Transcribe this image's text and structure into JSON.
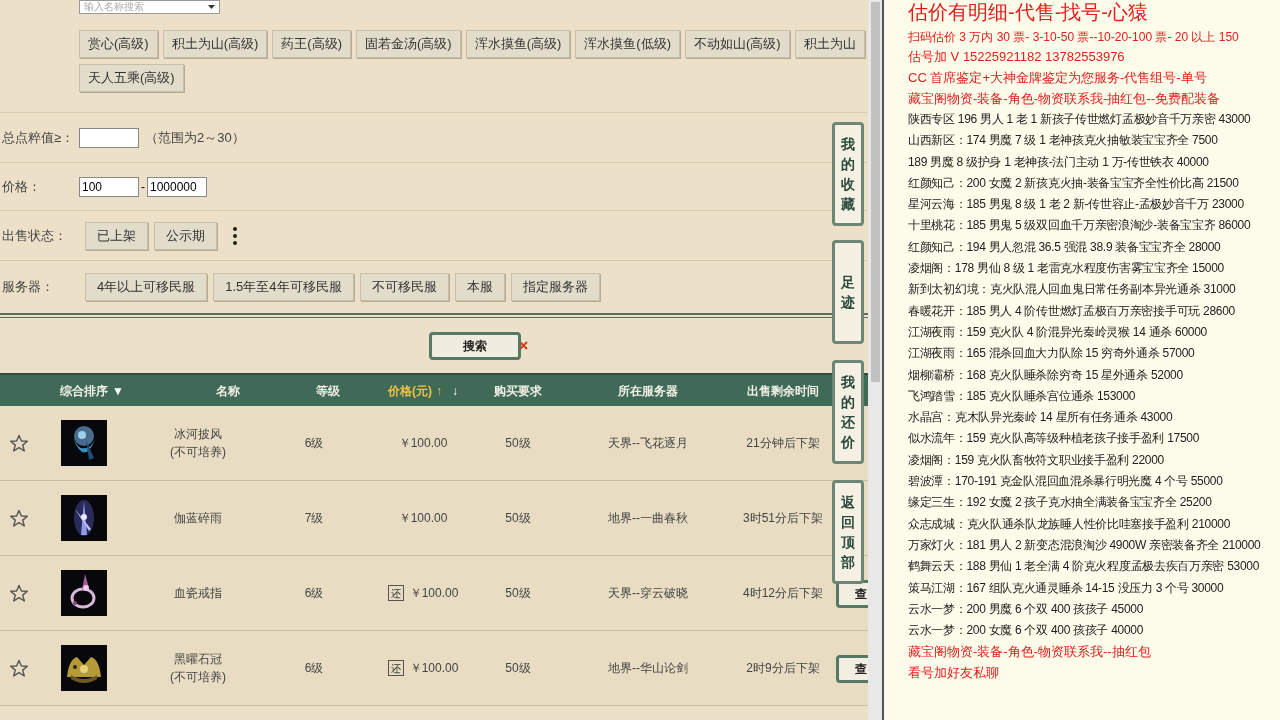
{
  "search_select": {
    "placeholder": "输入名称搜索"
  },
  "skill_buttons": [
    "赏心(高级)",
    "积土为山(高级)",
    "药王(高级)",
    "固若金汤(高级)",
    "浑水摸鱼(高级)",
    "浑水摸鱼(低级)",
    "不动如山(高级)",
    "积土为山",
    "天人五乘(高级)"
  ],
  "score_filter": {
    "label": "总点粹值≥：",
    "hint": "（范围为2～30）"
  },
  "price_filter": {
    "label": "价格：",
    "min": "100",
    "max": "1000000",
    "separator": "-"
  },
  "status_filter": {
    "label": "出售状态：",
    "options": [
      "已上架",
      "公示期"
    ]
  },
  "server_filter": {
    "label": "服务器：",
    "options": [
      "4年以上可移民服",
      "1.5年至4年可移民服",
      "不可移民服",
      "本服",
      "指定服务器"
    ]
  },
  "search_button": "搜索",
  "side_tabs": [
    "我的收藏",
    "足迹",
    "我的还价",
    "返回顶部"
  ],
  "table": {
    "columns": [
      {
        "label": "综合排序",
        "arrows": [
          "▼"
        ],
        "highlight": false
      },
      {
        "label": "名称",
        "highlight": false
      },
      {
        "label": "等级",
        "highlight": false
      },
      {
        "label": "价格(元)",
        "arrows": [
          "↑",
          "↓"
        ],
        "highlight": true
      },
      {
        "label": "购买要求",
        "highlight": false
      },
      {
        "label": "所在服务器",
        "highlight": false
      },
      {
        "label": "出售剩余时间",
        "highlight": false
      }
    ],
    "rows": [
      {
        "name": "冰河披风",
        "note": "(不可培养)",
        "level": "6级",
        "bargain": "",
        "price": "￥100.00",
        "requirement": "50级",
        "server": "天界--飞花逐月",
        "time_left": "21分钟后下架",
        "view_button": ""
      },
      {
        "name": "伽蓝碎雨",
        "note": "",
        "level": "7级",
        "bargain": "",
        "price": "￥100.00",
        "requirement": "50级",
        "server": "地界--一曲春秋",
        "time_left": "3时51分后下架",
        "view_button": ""
      },
      {
        "name": "血瓷戒指",
        "note": "",
        "level": "6级",
        "bargain": "还",
        "price": "￥100.00",
        "requirement": "50级",
        "server": "天界--穿云破晓",
        "time_left": "4时12分后下架",
        "view_button": "查"
      },
      {
        "name": "黑曜石冠",
        "note": "(不可培养)",
        "level": "6级",
        "bargain": "还",
        "price": "￥100.00",
        "requirement": "50级",
        "server": "地界--华山论剑",
        "time_left": "2时9分后下架",
        "view_button": "查"
      }
    ]
  },
  "notes": [
    {
      "text": "估价有明细-代售-找号-心猿",
      "kind": "title"
    },
    {
      "text": "扫码估价 3 万内 30 票- 3-10-50 票--10-20-100 票- 20 以上 150",
      "kind": "red-small"
    },
    {
      "text": "估号加 V 15225921182    13782553976",
      "kind": "red"
    },
    {
      "text": "CC 首席鉴定+大神金牌鉴定为您服务-代售组号-单号",
      "kind": "red"
    },
    {
      "text": "藏宝阁物资-装备-角色-物资联系我-抽红包--免费配装备",
      "kind": "red"
    },
    {
      "text": "陕西专区 196 男人 1 老 1 新孩子传世燃灯孟极妙音千万亲密 43000",
      "kind": "plain"
    },
    {
      "text": "山西新区：174 男魔 7 级 1 老神孩克火抽敏装宝宝齐全 7500",
      "kind": "plain"
    },
    {
      "text": "189 男魔 8 级护身 1 老神孩-法门主动 1 万-传世铁衣 40000",
      "kind": "plain"
    },
    {
      "text": "红颜知己：200 女魔 2 新孩克火抽-装备宝宝齐全性价比高 21500",
      "kind": "plain"
    },
    {
      "text": "星河云海：185 男鬼 8 级 1 老 2 新-传世容止-孟极妙音千万 23000",
      "kind": "plain"
    },
    {
      "text": "十里桃花：185 男鬼 5 级双回血千万亲密浪淘沙-装备宝宝齐 86000",
      "kind": "plain"
    },
    {
      "text": "红颜知己：194 男人忽混 36.5 强混 38.9 装备宝宝齐全 28000",
      "kind": "plain"
    },
    {
      "text": "凌烟阁：178 男仙 8 级 1 老雷克水程度伤害雾宝宝齐全 15000",
      "kind": "plain"
    },
    {
      "text": "新到太初幻境：克火队混人回血鬼日常任务副本异光通杀 31000",
      "kind": "plain"
    },
    {
      "text": "春暖花开：185 男人 4 阶传世燃灯孟极百万亲密接手可玩 28600",
      "kind": "plain"
    },
    {
      "text": "江湖夜雨：159 克火队 4 阶混异光秦岭灵猴 14 通杀 60000",
      "kind": "plain"
    },
    {
      "text": "江湖夜雨：165 混杀回血大力队除 15 穷奇外通杀 57000",
      "kind": "plain"
    },
    {
      "text": "烟柳灞桥：168 克火队睡杀除穷奇 15 星外通杀 52000",
      "kind": "plain"
    },
    {
      "text": "飞鸿踏雪：185 克火队睡杀宫位通杀 153000",
      "kind": "plain"
    },
    {
      "text": "水晶宫：克木队异光秦岭 14 星所有任务通杀 43000",
      "kind": "plain"
    },
    {
      "text": "似水流年：159 克火队高等级种植老孩子接手盈利 17500",
      "kind": "plain"
    },
    {
      "text": "凌烟阁：159 克火队畜牧符文职业接手盈利 22000",
      "kind": "plain"
    },
    {
      "text": "碧波潭：170-191 克金队混回血混杀暴行明光魔 4 个号 55000",
      "kind": "plain"
    },
    {
      "text": "缘定三生：192 女魔 2 孩子克水抽全满装备宝宝齐全 25200",
      "kind": "plain"
    },
    {
      "text": "众志成城：克火队通杀队龙族睡人性价比哇塞接手盈利 210000",
      "kind": "plain"
    },
    {
      "text": "万家灯火：181 男人 2 新变态混浪淘沙 4900W 亲密装备齐全 210000",
      "kind": "plain"
    },
    {
      "text": "鹤舞云天：188 男仙 1 老全满 4 阶克火程度孟极去疾百万亲密 53000",
      "kind": "plain"
    },
    {
      "text": "策马江湖：167 组队克火通灵睡杀 14-15 没压力 3 个号 30000",
      "kind": "plain"
    },
    {
      "text": "云水一梦：200 男魔 6 个双 400 孩孩子 45000",
      "kind": "plain"
    },
    {
      "text": "云水一梦：200 女魔 6 个双 400 孩孩子 40000",
      "kind": "plain"
    },
    {
      "text": "藏宝阁物资-装备-角色-物资联系我--抽红包",
      "kind": "red"
    },
    {
      "text": "看号加好友私聊",
      "kind": "red"
    }
  ]
}
